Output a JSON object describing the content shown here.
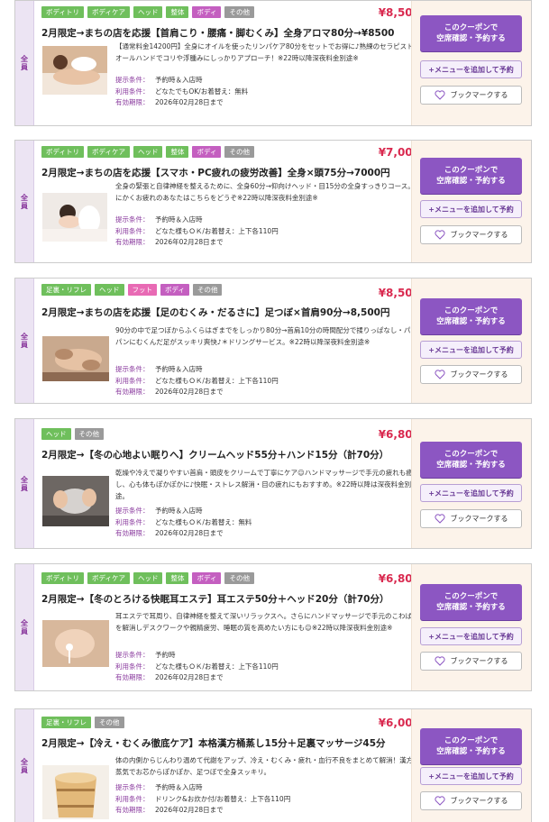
{
  "common": {
    "side_label": "全員",
    "coupon_btn_line1": "このクーポンで",
    "coupon_btn_line2": "空席確認・予約する",
    "menu_btn": "+メニューを追加して予約",
    "bookmark_btn": "ブックマークする",
    "cond_labels": {
      "presentation": "提示条件：",
      "usage": "利用条件：",
      "expiry": "有効期限："
    }
  },
  "cards": [
    {
      "tags": [
        {
          "label": "ボディトリ",
          "color": "#6fbf5c"
        },
        {
          "label": "ボディケア",
          "color": "#6fbf5c"
        },
        {
          "label": "ヘッド",
          "color": "#6fbf5c"
        },
        {
          "label": "整体",
          "color": "#6fbf5c"
        },
        {
          "label": "ボディ",
          "color": "#c45fc0"
        },
        {
          "label": "その他",
          "color": "#9a9a9a"
        }
      ],
      "price": "¥8,500",
      "title": "2月限定→まちの店を応援【首肩こり・腰痛・脚むくみ】全身アロマ80分→¥8500",
      "desc": "【通常料金14200円】全身にオイルを使ったリンパケア80分をセットでお得に♪熟練のセラピストがオールハンドでコリや浮腫みにしっかりアプローチ！※22時以降深夜料金別途※",
      "photo": "massage-photo",
      "presentation": "予約時＆入店時",
      "usage": "どなたでもOK/お着替え：無料",
      "expiry": "2026年02月28日まで"
    },
    {
      "tags": [
        {
          "label": "ボディトリ",
          "color": "#6fbf5c"
        },
        {
          "label": "ボディケア",
          "color": "#6fbf5c"
        },
        {
          "label": "ヘッド",
          "color": "#6fbf5c"
        },
        {
          "label": "整体",
          "color": "#6fbf5c"
        },
        {
          "label": "ボディ",
          "color": "#c45fc0"
        },
        {
          "label": "その他",
          "color": "#9a9a9a"
        }
      ],
      "price": "¥7,000",
      "title": "2月限定→まちの店を応援【スマホ・PC疲れの疲労改善】全身×頭75分→7000円",
      "desc": "全身の緊張と自律神経を整えるために、全身60分→仰向けヘッド・目15分の全身すっきりコース。とにかくお疲れのあなたはこちらをどうぞ※22時以降深夜料金別途※",
      "photo": "massage-photo",
      "presentation": "予約時＆入店時",
      "usage": "どなた様もＯＫ/お着替え：上下各110円",
      "expiry": "2026年02月28日まで"
    },
    {
      "tags": [
        {
          "label": "足裏・リフレ",
          "color": "#6fbf5c"
        },
        {
          "label": "ヘッド",
          "color": "#6fbf5c"
        },
        {
          "label": "フット",
          "color": "#e86ab4"
        },
        {
          "label": "ボディ",
          "color": "#c45fc0"
        },
        {
          "label": "その他",
          "color": "#9a9a9a"
        }
      ],
      "price": "¥8,500",
      "title": "2月限定→まちの店を応援【足のむくみ・だるさに】足つぼ×首肩90分→8,500円",
      "desc": "90分の中で足つぼからふくらはぎまでをしっかり80分→首肩10分の時間配分で揉りっぱなし・パンパンにむくんだ足がスッキリ爽快♪＊ドリングサービス。※22時以降深夜料金別途※",
      "photo": "foot-photo",
      "presentation": "予約時＆入店時",
      "usage": "どなた様もＯＫ/お着替え：上下各110円",
      "expiry": "2026年02月28日まで"
    },
    {
      "tags": [
        {
          "label": "ヘッド",
          "color": "#6fbf5c"
        },
        {
          "label": "その他",
          "color": "#9a9a9a"
        }
      ],
      "price": "¥6,800",
      "title": "2月限定→【冬の心地よい眠りへ】クリームヘッド55分＋ハンド15分（計70分）",
      "desc": "乾燥や冷えで凝りやすい首肩・頭皮をクリームで丁寧にケア☺ハンドマッサージで手元の疲れも癒し、心も体もぽかぽかに♪快眠・ストレス解消・目の疲れにもおすすめ。※22時以降は深夜料金別途。",
      "photo": "head-photo",
      "presentation": "予約時＆入店時",
      "usage": "どなた様もＯＫ/お着替え：無料",
      "expiry": "2026年02月28日まで"
    },
    {
      "tags": [
        {
          "label": "ボディトリ",
          "color": "#6fbf5c"
        },
        {
          "label": "ボディケア",
          "color": "#6fbf5c"
        },
        {
          "label": "ヘッド",
          "color": "#6fbf5c"
        },
        {
          "label": "整体",
          "color": "#6fbf5c"
        },
        {
          "label": "ボディ",
          "color": "#c45fc0"
        },
        {
          "label": "その他",
          "color": "#9a9a9a"
        }
      ],
      "price": "¥6,800",
      "title": "2月限定→【冬のとろける快眠耳エステ】耳エステ50分＋ヘッド20分（計70分）",
      "desc": "耳エステで耳周り、自律神経を整えて深いリラックスへ。さらにハンドマッサージで手元のこわばりを解消しデスクワークや親精疲労、睡眠の質を高めたい方にも☺※22時以降深夜料金別途※",
      "photo": "ear-photo",
      "presentation": "予約時",
      "usage": "どなた様もＯＫ/お着替え：上下各110円",
      "expiry": "2026年02月28日まで"
    },
    {
      "tags": [
        {
          "label": "足裏・リフレ",
          "color": "#6fbf5c"
        },
        {
          "label": "その他",
          "color": "#9a9a9a"
        }
      ],
      "price": "¥6,000",
      "title": "2月限定→【冷え・むくみ徹底ケア】本格漢方桶蒸し15分＋足裏マッサージ45分",
      "desc": "体の内側からじんわり温めて代謝をアップ、冷え・むくみ・疲れ・血行不良をまとめて解消！漢方の蒸気でお芯からぽかぽか、足つぼで全身スッキリ。",
      "photo": "barrel-photo",
      "presentation": "予約時＆入店時",
      "usage": "ドリンク&お炊か付/お着替え：上下各110円",
      "expiry": "2026年02月28日まで"
    }
  ]
}
